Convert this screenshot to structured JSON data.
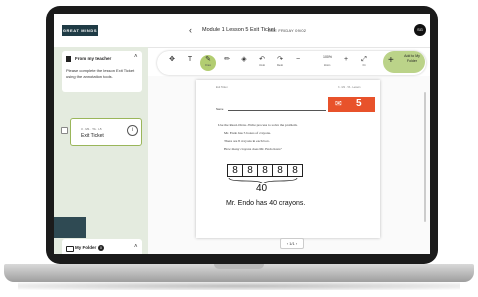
{
  "header": {
    "logo_text": "GREAT MINDS",
    "back_arrow": "‹",
    "title": "Module 1 Lesson 5 Exit Ticket",
    "due": "DUE FRIDAY 09/02",
    "avatar_initials": "SG"
  },
  "left_panel": {
    "teacher_card": {
      "heading": "From my teacher",
      "message": "Please complete the lesson Exit Ticket using the annotation tools."
    },
    "exit_ticket": {
      "subtitle": "3 · M1 · TA · L5",
      "title": "Exit Ticket"
    },
    "folder": {
      "label": "My Folder",
      "count": "0"
    }
  },
  "toolbar": {
    "tools": [
      {
        "icon": "move-icon",
        "glyph": "✥",
        "label": ""
      },
      {
        "icon": "text-icon",
        "glyph": "T",
        "label": ""
      },
      {
        "icon": "pen-icon",
        "glyph": "✎",
        "label": "Draw"
      },
      {
        "icon": "pencil-icon",
        "glyph": "✏",
        "label": ""
      },
      {
        "icon": "eraser-icon",
        "glyph": "◈",
        "label": ""
      },
      {
        "icon": "undo-icon",
        "glyph": "↶",
        "label": "Undo"
      },
      {
        "icon": "redo-icon",
        "glyph": "↷",
        "label": "Redo"
      },
      {
        "icon": "zoom-out-icon",
        "glyph": "−",
        "label": ""
      },
      {
        "icon": "zoom-in-icon",
        "glyph": "+",
        "label": ""
      },
      {
        "icon": "fit-icon",
        "glyph": "⤢",
        "label": "Fit"
      }
    ],
    "zoom_value": "100%",
    "zoom_label": "Zoom",
    "add_to_folder": "Add to My Folder"
  },
  "document": {
    "header_left": "Exit Ticket",
    "header_right": "3 · M1 · TA · Lesson",
    "name_label": "Name",
    "ticket_number": "5",
    "lines": [
      "Use the Read–Draw–Write process to solve the problem.",
      "Mr. Endo has 5 boxes of crayons.",
      "There are 8 crayons in each box.",
      "How many crayons does Mr. Endo have?"
    ],
    "eights": [
      "8",
      "8",
      "8",
      "8",
      "8"
    ],
    "total": "40",
    "answer": "Mr. Endo has 40 crayons.",
    "pager": "‹ 1/1 ›"
  },
  "colors": {
    "accent_green": "#b2cd71",
    "panel_bg": "#e4ebdf",
    "ticket_orange": "#e8522b",
    "logo_bg": "#1f3b45"
  }
}
